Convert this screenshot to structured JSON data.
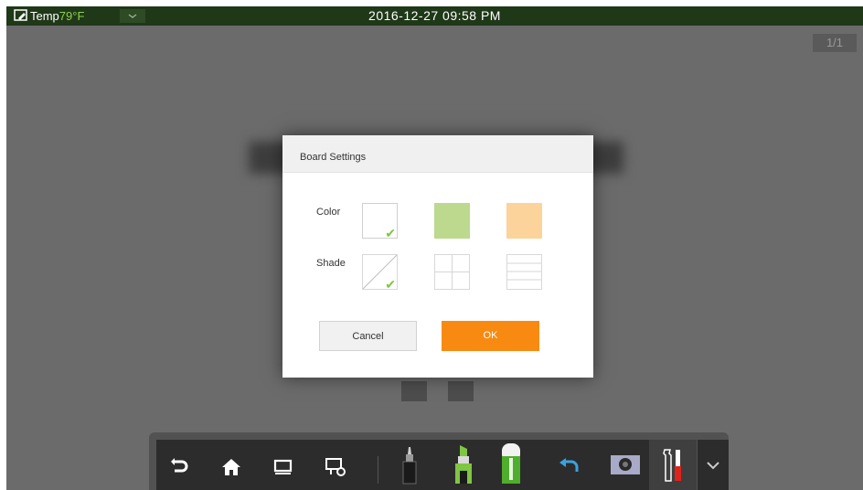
{
  "status_bar": {
    "temp_label": "Temp",
    "temp_value": "79°F",
    "datetime": "2016-12-27  09:58  PM"
  },
  "page_indicator": "1/1",
  "dialog": {
    "title": "Board Settings",
    "color_label": "Color",
    "shade_label": "Shade",
    "cancel_label": "Cancel",
    "ok_label": "OK",
    "colors": [
      "#ffffff",
      "#bcd98e",
      "#fcd39a"
    ],
    "selected_color": "#ffffff",
    "selected_shade": "diagonal"
  },
  "toolbar": {
    "icons": [
      "exit-icon",
      "home-icon",
      "screen-icon",
      "settings-icon",
      "pen-icon",
      "highlighter-icon",
      "eraser-icon",
      "undo-icon",
      "camera-icon",
      "tools-icon",
      "chevron-down-icon"
    ]
  },
  "colors": {
    "status_bar": "#1f3818",
    "temp_value": "#8fd14a",
    "accent": "#f88a12",
    "check": "#7fc641",
    "background": "#6b6b6b"
  }
}
